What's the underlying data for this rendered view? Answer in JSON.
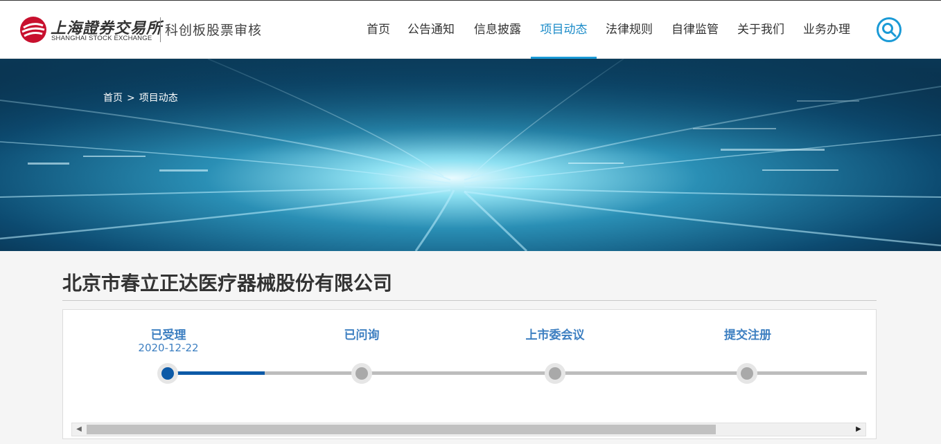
{
  "header": {
    "logo_cn": "上海證券交易所",
    "logo_en": "SHANGHAI STOCK EXCHANGE",
    "logo_sub": "科创板股票审核",
    "nav": [
      {
        "label": "首页"
      },
      {
        "label": "公告通知"
      },
      {
        "label": "信息披露"
      },
      {
        "label": "项目动态",
        "active": true
      },
      {
        "label": "法律规则"
      },
      {
        "label": "自律监管"
      },
      {
        "label": "关于我们"
      },
      {
        "label": "业务办理"
      }
    ],
    "search_icon": "search-icon"
  },
  "banner": {
    "breadcrumb": {
      "home": "首页",
      "separator": ">",
      "current": "项目动态"
    }
  },
  "company": {
    "title": "北京市春立正达医疗器械股份有限公司"
  },
  "progress": {
    "steps": [
      {
        "label": "已受理",
        "date": "2020-12-22",
        "done": true
      },
      {
        "label": "已问询",
        "date": "",
        "done": false
      },
      {
        "label": "上市委会议",
        "date": "",
        "done": false
      },
      {
        "label": "提交注册",
        "date": "",
        "done": false
      }
    ],
    "fill_fraction_of_first_segment": 0.5
  },
  "colors": {
    "accent": "#1a9ad6",
    "step_text": "#3d7fc1",
    "step_done": "#0d5aa7",
    "step_pending": "#a9a9a9"
  }
}
